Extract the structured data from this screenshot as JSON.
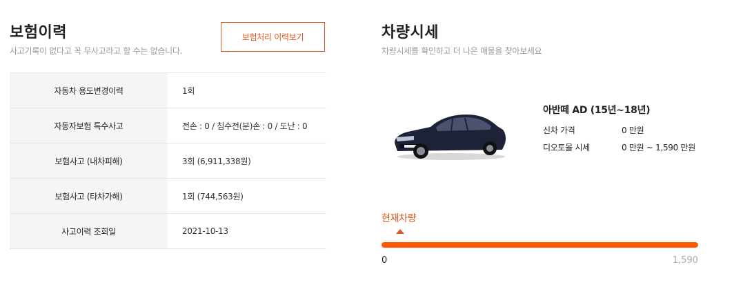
{
  "insurance": {
    "title": "보험이력",
    "subtitle": "사고기록이 없다고 꼭 무사고라고 할 수는 없습니다.",
    "history_button": "보험처리 이력보기",
    "rows": [
      {
        "label": "자동차 용도변경이력",
        "value": "1회"
      },
      {
        "label": "자동자보험 특수사고",
        "value": "전손 : 0 / 침수전(분)손 : 0 / 도난 : 0"
      },
      {
        "label": "보험사고 (내차피해)",
        "value": "3회 (6,911,338원)"
      },
      {
        "label": "보험사고 (타차가해)",
        "value": "1회 (744,563원)"
      },
      {
        "label": "사고이력 조회일",
        "value": "2021-10-13"
      }
    ]
  },
  "market": {
    "title": "차량시세",
    "subtitle": "차량시세를 확인하고 더 나은 매물을 찾아보세요",
    "car_name": "아반떼 AD (15년~18년)",
    "new_price_label": "신차 가격",
    "new_price_value": "0 만원",
    "market_price_label": "디오토몰 시세",
    "market_price_value": "0 만원 ~ 1,590 만원",
    "current_label": "현재차량",
    "range_min": "0",
    "range_max": "1,590",
    "bar_fill_fraction": 1.0,
    "accent_color": "#ff5a00"
  }
}
